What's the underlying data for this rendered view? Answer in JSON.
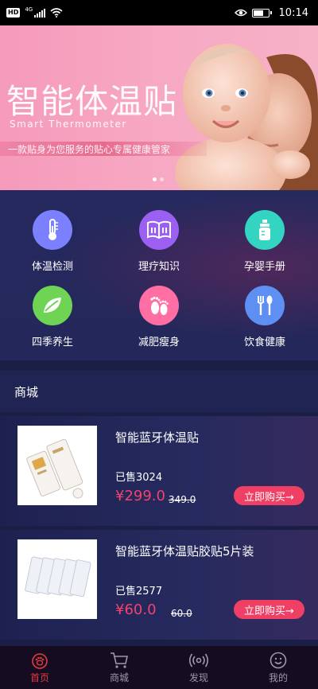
{
  "status_bar": {
    "hd": "HD",
    "network": "4G",
    "time": "10:14"
  },
  "banner": {
    "title": "智能体温贴",
    "subtitle": "Smart Thermometer",
    "slogan": "一款贴身为您服务的贴心专属健康管家"
  },
  "categories": [
    {
      "label": "体温检测",
      "icon": "thermometer-icon",
      "color": "#7b80ff"
    },
    {
      "label": "理疗知识",
      "icon": "book-icon",
      "color": "#9b5ff2"
    },
    {
      "label": "孕婴手册",
      "icon": "baby-bottle-icon",
      "color": "#33d4c1"
    },
    {
      "label": "四季养生",
      "icon": "leaf-icon",
      "color": "#6fd354"
    },
    {
      "label": "减肥瘦身",
      "icon": "footprint-icon",
      "color": "#ff6fa3"
    },
    {
      "label": "饮食健康",
      "icon": "fork-spoon-icon",
      "color": "#5e8ff2"
    }
  ],
  "shop": {
    "title": "商城",
    "products": [
      {
        "name": "智能蓝牙体温贴",
        "sold": "已售3024",
        "price": "¥299.0",
        "old_price": "349.0",
        "buy_label": "立即购买→"
      },
      {
        "name": "智能蓝牙体温贴胶贴5片装",
        "sold": "已售2577",
        "price": "¥60.0",
        "old_price": "60.0",
        "buy_label": "立即购买→"
      }
    ]
  },
  "nav": {
    "items": [
      {
        "label": "首页",
        "icon": "home-paw-icon",
        "active": true
      },
      {
        "label": "商城",
        "icon": "cart-icon",
        "active": false
      },
      {
        "label": "发现",
        "icon": "radar-icon",
        "active": false
      },
      {
        "label": "我的",
        "icon": "user-icon",
        "active": false
      }
    ]
  }
}
